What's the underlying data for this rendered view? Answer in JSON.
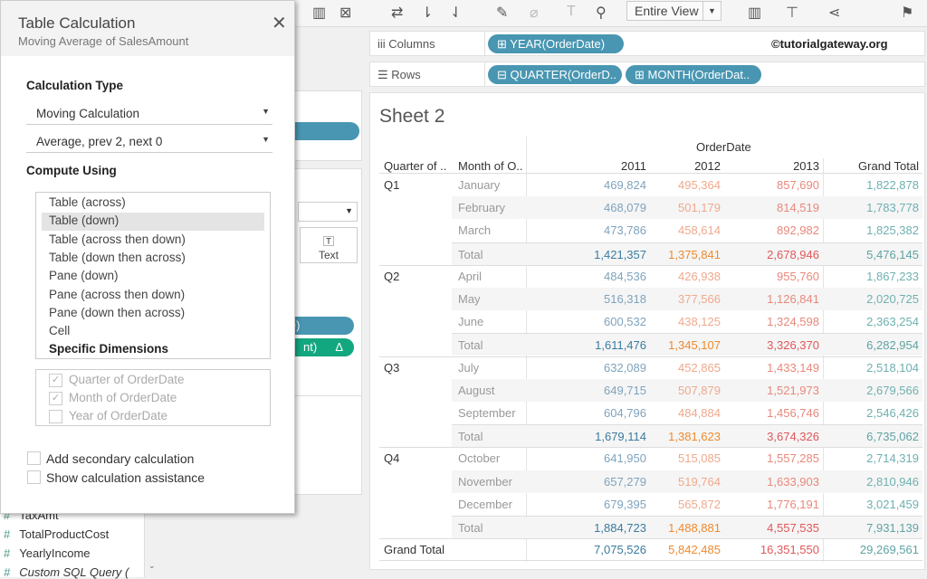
{
  "toolbar": {
    "view_select": "Entire View"
  },
  "shelves": {
    "columns_label": "Columns",
    "rows_label": "Rows",
    "columns_pills": [
      "YEAR(OrderDate)"
    ],
    "rows_pills": [
      "QUARTER(OrderD..",
      "MONTH(OrderDat.."
    ]
  },
  "watermark": "©tutorialgateway.org",
  "marks": {
    "text_label": "Text",
    "pill1": "ate)",
    "pill2": "nt)",
    "delta": "Δ"
  },
  "sidebar": {
    "fields": [
      "TaxAmt",
      "TotalProductCost",
      "YearlyIncome",
      "Custom SQL Query ("
    ]
  },
  "sheet": {
    "title": "Sheet 2"
  },
  "table": {
    "header_group": "OrderDate",
    "headers": [
      "Quarter of ..",
      "Month of O..",
      "2011",
      "2012",
      "2013",
      "Grand Total"
    ],
    "total_label": "Total",
    "grand_total_label": "Grand Total",
    "quarters": [
      {
        "label": "Q1",
        "months": [
          {
            "name": "January",
            "values": [
              "469,824",
              "495,364",
              "857,690",
              "1,822,878"
            ]
          },
          {
            "name": "February",
            "values": [
              "468,079",
              "501,179",
              "814,519",
              "1,783,778"
            ]
          },
          {
            "name": "March",
            "values": [
              "473,786",
              "458,614",
              "892,982",
              "1,825,382"
            ]
          }
        ],
        "total": [
          "1,421,357",
          "1,375,841",
          "2,678,946",
          "5,476,145"
        ]
      },
      {
        "label": "Q2",
        "months": [
          {
            "name": "April",
            "values": [
              "484,536",
              "426,938",
              "955,760",
              "1,867,233"
            ]
          },
          {
            "name": "May",
            "values": [
              "516,318",
              "377,566",
              "1,126,841",
              "2,020,725"
            ]
          },
          {
            "name": "June",
            "values": [
              "600,532",
              "438,125",
              "1,324,598",
              "2,363,254"
            ]
          }
        ],
        "total": [
          "1,611,476",
          "1,345,107",
          "3,326,370",
          "6,282,954"
        ]
      },
      {
        "label": "Q3",
        "months": [
          {
            "name": "July",
            "values": [
              "632,089",
              "452,865",
              "1,433,149",
              "2,518,104"
            ]
          },
          {
            "name": "August",
            "values": [
              "649,715",
              "507,879",
              "1,521,973",
              "2,679,566"
            ]
          },
          {
            "name": "September",
            "values": [
              "604,796",
              "484,884",
              "1,456,746",
              "2,546,426"
            ]
          }
        ],
        "total": [
          "1,679,114",
          "1,381,623",
          "3,674,326",
          "6,735,062"
        ]
      },
      {
        "label": "Q4",
        "months": [
          {
            "name": "October",
            "values": [
              "641,950",
              "515,085",
              "1,557,285",
              "2,714,319"
            ]
          },
          {
            "name": "November",
            "values": [
              "657,279",
              "519,764",
              "1,633,903",
              "2,810,946"
            ]
          },
          {
            "name": "December",
            "values": [
              "679,395",
              "565,872",
              "1,776,191",
              "3,021,459"
            ]
          }
        ],
        "total": [
          "1,884,723",
          "1,488,881",
          "4,557,535",
          "7,931,139"
        ]
      }
    ],
    "grand_total": [
      "7,075,526",
      "5,842,485",
      "16,351,550",
      "29,269,561"
    ],
    "colors": {
      "light": [
        "#7fa3bd",
        "#f0a98c",
        "#e8887c",
        "#6fb0b0"
      ],
      "total": [
        "#3a7ca0",
        "#f08a2c",
        "#e15759",
        "#5fa3a3"
      ]
    }
  },
  "dialog": {
    "title": "Table Calculation",
    "subtitle": "Moving Average of SalesAmount",
    "calc_type_heading": "Calculation Type",
    "calc_type": "Moving Calculation",
    "calc_summary": "Average, prev 2, next 0",
    "compute_using_heading": "Compute Using",
    "compute_options": [
      "Table (across)",
      "Table (down)",
      "Table (across then down)",
      "Table (down then across)",
      "Pane (down)",
      "Pane (across then down)",
      "Pane (down then across)",
      "Cell",
      "Specific Dimensions"
    ],
    "selected_option": "Table (down)",
    "dimensions": [
      {
        "label": "Quarter of OrderDate",
        "checked": true
      },
      {
        "label": "Month of OrderDate",
        "checked": true
      },
      {
        "label": "Year of OrderDate",
        "checked": false
      }
    ],
    "add_secondary": "Add secondary calculation",
    "show_assistance": "Show calculation assistance"
  }
}
